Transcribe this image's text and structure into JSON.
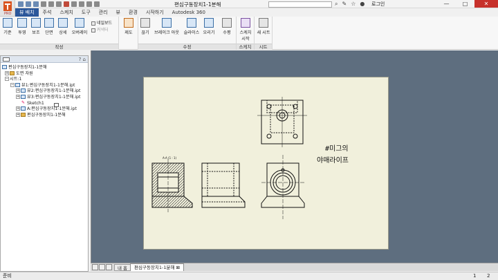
{
  "window": {
    "title": "편심구동장치1-1분해",
    "search_placeholder": "",
    "login_label": "로그인",
    "controls": {
      "minimize": "—",
      "maximize": "□",
      "close": "✕"
    }
  },
  "tabs": [
    {
      "label": "뷰 배치",
      "active": true
    },
    {
      "label": "주석",
      "active": false
    },
    {
      "label": "스케치",
      "active": false
    },
    {
      "label": "도구",
      "active": false
    },
    {
      "label": "관리",
      "active": false
    },
    {
      "label": "뷰",
      "active": false
    },
    {
      "label": "환경",
      "active": false
    },
    {
      "label": "시작하기",
      "active": false
    },
    {
      "label": "Autodesk 360",
      "active": false
    }
  ],
  "ribbon": {
    "create_panel": {
      "label": "작성",
      "buttons": [
        "기준",
        "투영",
        "보조",
        "단면",
        "상세",
        "오버레이"
      ],
      "small_buttons": [
        "네일보드",
        "커넥터"
      ]
    },
    "draft_button": "제도",
    "modify_panel": {
      "label": "수정",
      "buttons": [
        "끊기",
        "브레이크 아웃",
        "슬라이스",
        "오리기"
      ],
      "align_label": "수평"
    },
    "sketch_panel": {
      "label": "스케치",
      "button": "스케치 시작"
    },
    "sheet_panel": {
      "label": "시트",
      "button": "새 시트"
    }
  },
  "browser": {
    "header_icons": "? ⌂",
    "nodes": [
      {
        "label": "편심구동장치1-1분해",
        "indent": 0,
        "expander": "",
        "icon": "view"
      },
      {
        "label": "도면 자원",
        "indent": 1,
        "expander": "+",
        "icon": "folder"
      },
      {
        "label": "시트:1",
        "indent": 1,
        "expander": "−",
        "icon": "sheet"
      },
      {
        "label": "뷰1:편심구동장치1-1분해.ipt",
        "indent": 2,
        "expander": "−",
        "icon": "view"
      },
      {
        "label": "뷰2:편심구동장치1-1분해.ipt",
        "indent": 3,
        "expander": "+",
        "icon": "view"
      },
      {
        "label": "뷰3:편심구동장치1-1분해.ipt",
        "indent": 3,
        "expander": "+",
        "icon": "view"
      },
      {
        "label": "Sketch1",
        "indent": 3,
        "expander": "",
        "icon": "sketch"
      },
      {
        "label": "A:편심구동장치1-1분해.ipt",
        "indent": 3,
        "expander": "+",
        "icon": "view"
      },
      {
        "label": "편심구동장치1-1분해",
        "indent": 3,
        "expander": "+",
        "icon": "folder"
      }
    ]
  },
  "drawing": {
    "annotation_line1": "#미그의",
    "annotation_line2": "야매라이프",
    "section_label": "A-A (1 : 1)"
  },
  "doc_tabs": {
    "home": "내 홈",
    "active": "편심구동장치1-1분해",
    "close": "⊠"
  },
  "status": {
    "text": "준비",
    "num1": "1",
    "num2": "2"
  }
}
